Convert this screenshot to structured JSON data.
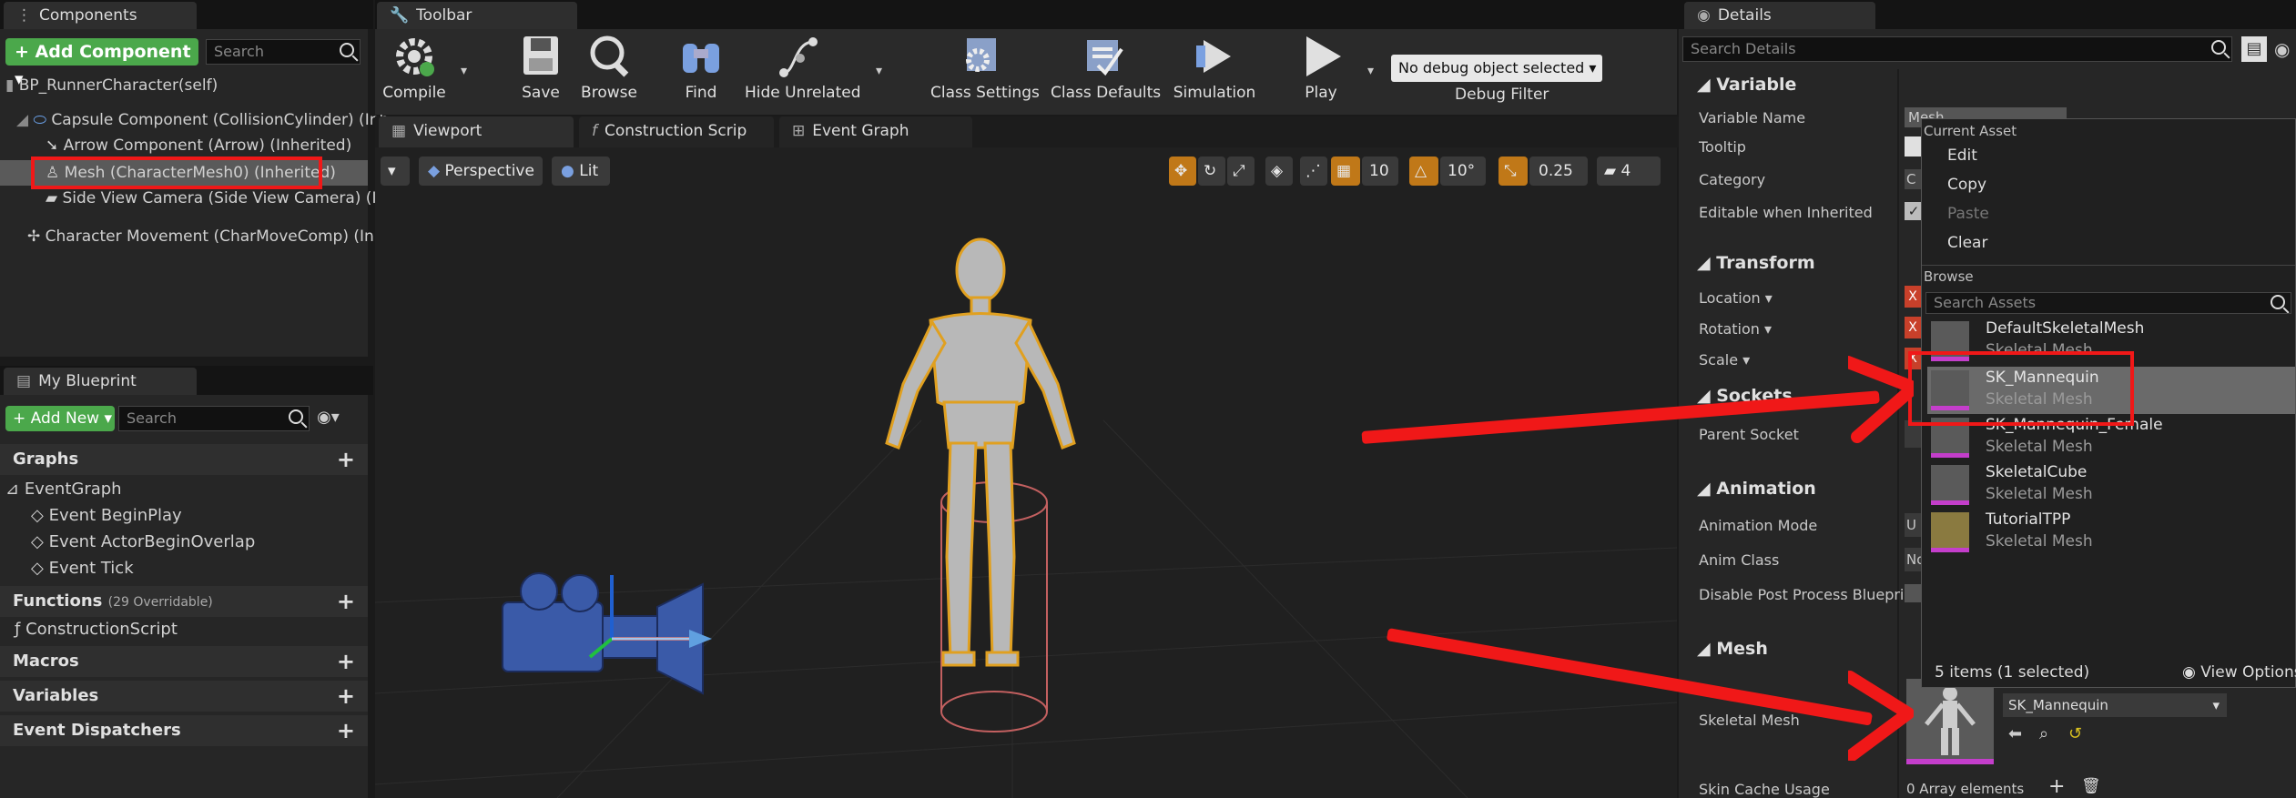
{
  "components": {
    "tab": "Components",
    "add_button": "Add Component",
    "search_placeholder": "Search",
    "root": "BP_RunnerCharacter(self)",
    "items": [
      "Capsule Component (CollisionCylinder) (Inh",
      "Arrow Component (Arrow) (Inherited)",
      "Mesh (CharacterMesh0) (Inherited)",
      "Side View Camera (Side View Camera) (Inh",
      "Character Movement (CharMoveComp) (Inh"
    ]
  },
  "my_blueprint": {
    "tab": "My Blueprint",
    "add_button": "Add New",
    "search_placeholder": "Search",
    "graphs": "Graphs",
    "event_graph": "EventGraph",
    "events": [
      "Event BeginPlay",
      "Event ActorBeginOverlap",
      "Event Tick"
    ],
    "functions": "Functions",
    "functions_count": "(29 Overridable)",
    "construction_script": "ConstructionScript",
    "macros": "Macros",
    "variables": "Variables",
    "dispatchers": "Event Dispatchers"
  },
  "toolbar": {
    "tab": "Toolbar",
    "buttons": [
      "Compile",
      "Save",
      "Browse",
      "Find",
      "Hide Unrelated",
      "Class Settings",
      "Class Defaults",
      "Simulation",
      "Play"
    ],
    "debug_select": "No debug object selected",
    "debug_filter": "Debug Filter"
  },
  "editor_tabs": [
    "Viewport",
    "Construction Scrip",
    "Event Graph"
  ],
  "viewport": {
    "perspective": "Perspective",
    "lit": "Lit",
    "grid_value": "10",
    "rotation_value": "10°",
    "scale_value": "0.25",
    "camera_speed": "4"
  },
  "details": {
    "tab": "Details",
    "search_placeholder": "Search Details",
    "sections": {
      "variable": "Variable",
      "transform": "Transform",
      "sockets": "Sockets",
      "animation": "Animation",
      "mesh": "Mesh"
    },
    "rows": {
      "variable_name": "Variable Name",
      "variable_name_value": "Mesh",
      "tooltip": "Tooltip",
      "category": "Category",
      "category_value": "C",
      "editable": "Editable when Inherited",
      "location": "Location",
      "rotation": "Rotation",
      "scale": "Scale",
      "parent_socket": "Parent Socket",
      "animation_mode": "Animation Mode",
      "animation_mode_value": "U",
      "anim_class": "Anim Class",
      "anim_class_value": "No",
      "disable_pp": "Disable Post Process Blueprint",
      "skeletal_mesh": "Skeletal Mesh",
      "skeletal_mesh_value": "SK_Mannequin",
      "skin_cache": "Skin Cache Usage",
      "skin_cache_value": "0 Array elements"
    }
  },
  "asset_menu": {
    "current_asset": "Current Asset",
    "actions": [
      "Edit",
      "Copy",
      "Paste",
      "Clear"
    ],
    "browse": "Browse",
    "search_placeholder": "Search Assets",
    "assets": [
      {
        "name": "DefaultSkeletalMesh",
        "type": "Skeletal Mesh"
      },
      {
        "name": "SK_Mannequin",
        "type": "Skeletal Mesh"
      },
      {
        "name": "SK_Mannequin_Female",
        "type": "Skeletal Mesh"
      },
      {
        "name": "SkeletalCube",
        "type": "Skeletal Mesh"
      },
      {
        "name": "TutorialTPP",
        "type": "Skeletal Mesh"
      }
    ],
    "count": "5 items (1 selected)",
    "view_options": "View Options"
  },
  "colors": {
    "accent_green": "#4ba84b",
    "highlight_red": "#f01818",
    "selection_orange": "#e0a020",
    "thumb_magenta": "#c43ecb"
  }
}
